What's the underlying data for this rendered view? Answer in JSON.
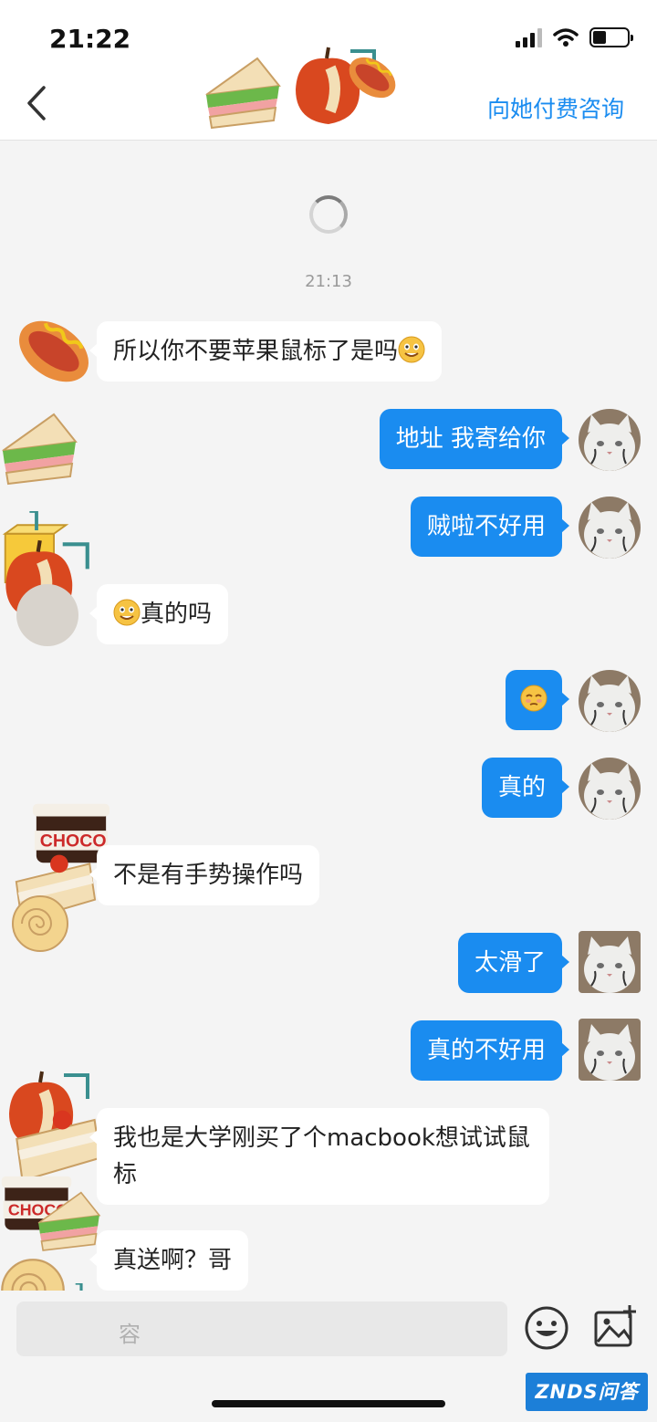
{
  "status_bar": {
    "time": "21:22"
  },
  "nav": {
    "title": "",
    "pay_button": "向她付费咨询"
  },
  "chat": {
    "timestamp": "21:13",
    "messages": [
      {
        "side": "in",
        "text": "所以你不要苹果鼠标了是吗",
        "emoji": "grin-emoji"
      },
      {
        "side": "out",
        "text": "地址 我寄给你"
      },
      {
        "side": "out",
        "text": "贼啦不好用"
      },
      {
        "side": "in",
        "text": "真的吗",
        "emoji": "grin-emoji"
      },
      {
        "side": "out",
        "text": "",
        "emoji": "pleading-emoji"
      },
      {
        "side": "out",
        "text": "真的"
      },
      {
        "side": "in",
        "text": "不是有手势操作吗"
      },
      {
        "side": "out",
        "text": "太滑了"
      },
      {
        "side": "out",
        "text": "真的不好用"
      },
      {
        "side": "in",
        "text": "我也是大学刚买了个macbook想试试鼠标"
      },
      {
        "side": "in",
        "text": "真送啊？哥"
      }
    ]
  },
  "input": {
    "placeholder": "容"
  },
  "watermark": "ZNDS问答",
  "colors": {
    "accent": "#1a8cf0",
    "background": "#f4f4f4",
    "bubble_in": "#ffffff"
  }
}
